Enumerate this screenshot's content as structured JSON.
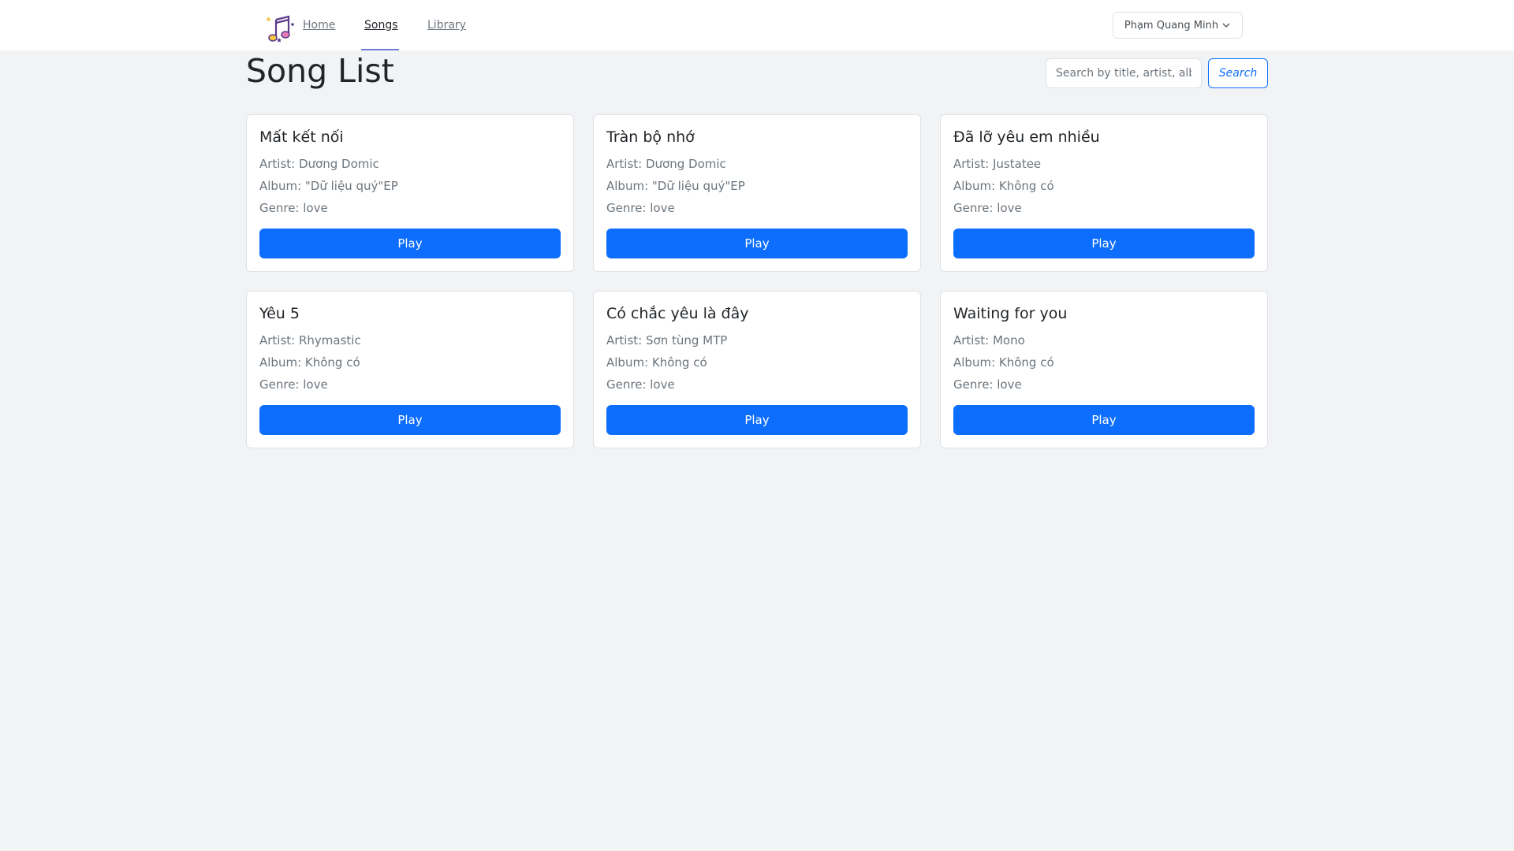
{
  "nav": {
    "logo_icon": "music-notes-icon",
    "links": [
      {
        "label": "Home",
        "active": false
      },
      {
        "label": "Songs",
        "active": true
      },
      {
        "label": "Library",
        "active": false
      }
    ],
    "user_name": "Phạm Quang Minh"
  },
  "main": {
    "title": "Song List",
    "search": {
      "placeholder": "Search by title, artist, album",
      "button_label": "Search"
    },
    "songs": [
      {
        "title": "Mất kết nối",
        "artist": "Artist: Dương Domic",
        "album": "Album: \"Dữ liệu quý\"EP",
        "genre": "Genre: love",
        "play_label": "Play"
      },
      {
        "title": "Tràn bộ nhớ",
        "artist": "Artist: Dương Domic",
        "album": "Album: \"Dữ liệu quý\"EP",
        "genre": "Genre: love",
        "play_label": "Play"
      },
      {
        "title": "Đã lỡ yêu em nhiều",
        "artist": "Artist: Justatee",
        "album": "Album: Không có",
        "genre": "Genre: love",
        "play_label": "Play"
      },
      {
        "title": "Yêu 5",
        "artist": "Artist: Rhymastic",
        "album": "Album: Không có",
        "genre": "Genre: love",
        "play_label": "Play"
      },
      {
        "title": "Có chắc yêu là đây",
        "artist": "Artist: Sơn tùng MTP",
        "album": "Album: Không có",
        "genre": "Genre: love",
        "play_label": "Play"
      },
      {
        "title": "Waiting for you",
        "artist": "Artist: Mono",
        "album": "Album: Không có",
        "genre": "Genre: love",
        "play_label": "Play"
      }
    ]
  },
  "colors": {
    "primary": "#0d6efd",
    "background": "#f2f3f5",
    "active_underline": "#6f7dd6"
  }
}
